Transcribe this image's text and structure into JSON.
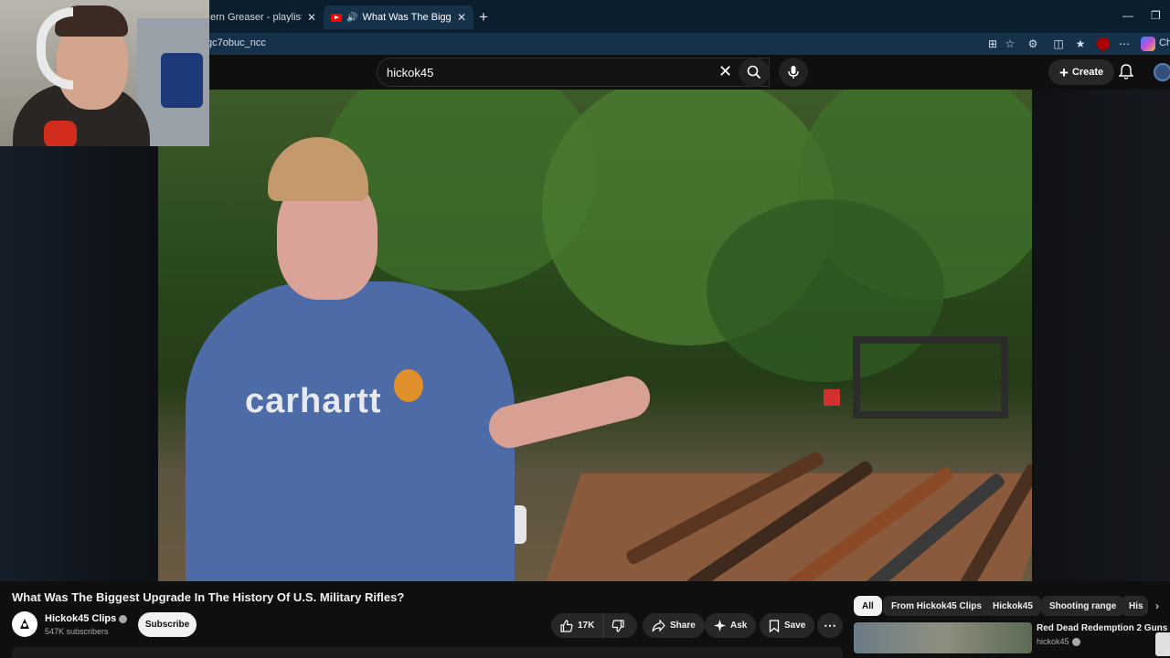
{
  "browser": {
    "tabs": [
      {
        "title": "ern Greaser - playlist by Rich",
        "active": false
      },
      {
        "title": "What Was The Biggest Upgra",
        "active": true
      }
    ],
    "url": "gc7obuc_ncc",
    "copilot_label": "Ch"
  },
  "youtube": {
    "search_value": "hickok45",
    "create_label": "Create",
    "video_title": "What Was The Biggest Upgrade In The History Of U.S. Military Rifles?",
    "channel": {
      "name": "Hickok45 Clips",
      "subscribers": "547K subscribers"
    },
    "subscribe_label": "Subscribe",
    "actions": {
      "likes": "17K",
      "share": "Share",
      "ask": "Ask",
      "save": "Save"
    },
    "video_overlay": {
      "shirt_text": "carhartt"
    },
    "chips": [
      "All",
      "From Hickok45 Clips",
      "Hickok45",
      "Shooting range",
      "His"
    ],
    "recommendation": {
      "title": "Red Dead Redemption 2 Guns",
      "channel": "hickok45"
    }
  },
  "colors": {
    "accent_red": "#ff0000",
    "page_bg": "#0f0f0f",
    "browser_bg": "#0b1e2e"
  }
}
